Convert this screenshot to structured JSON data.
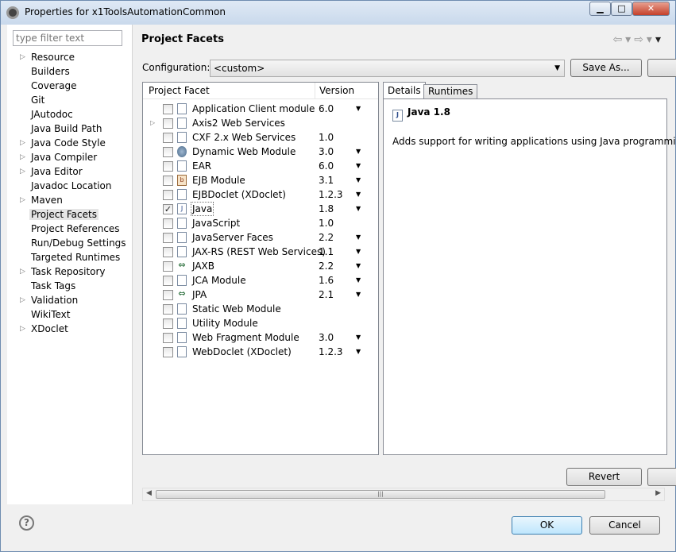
{
  "window": {
    "title": "Properties for x1ToolsAutomationCommon"
  },
  "filter": {
    "placeholder": "type filter text"
  },
  "tree": [
    {
      "label": "Resource",
      "expandable": true
    },
    {
      "label": "Builders",
      "expandable": false
    },
    {
      "label": "Coverage",
      "expandable": false
    },
    {
      "label": "Git",
      "expandable": false
    },
    {
      "label": "JAutodoc",
      "expandable": false
    },
    {
      "label": "Java Build Path",
      "expandable": false
    },
    {
      "label": "Java Code Style",
      "expandable": true
    },
    {
      "label": "Java Compiler",
      "expandable": true
    },
    {
      "label": "Java Editor",
      "expandable": true
    },
    {
      "label": "Javadoc Location",
      "expandable": false
    },
    {
      "label": "Maven",
      "expandable": true
    },
    {
      "label": "Project Facets",
      "expandable": false,
      "selected": true
    },
    {
      "label": "Project References",
      "expandable": false
    },
    {
      "label": "Run/Debug Settings",
      "expandable": false
    },
    {
      "label": "Targeted Runtimes",
      "expandable": false
    },
    {
      "label": "Task Repository",
      "expandable": true
    },
    {
      "label": "Task Tags",
      "expandable": false
    },
    {
      "label": "Validation",
      "expandable": true
    },
    {
      "label": "WikiText",
      "expandable": false
    },
    {
      "label": "XDoclet",
      "expandable": true
    }
  ],
  "page": {
    "title": "Project Facets"
  },
  "configuration": {
    "label": "Configuration:",
    "value": "<custom>",
    "save_as": "Save As..."
  },
  "facets": {
    "col_facet": "Project Facet",
    "col_version": "Version",
    "rows": [
      {
        "name": "Application Client module",
        "version": "6.0",
        "dropdown": true,
        "checked": false,
        "icon": "page-icon"
      },
      {
        "name": "Axis2 Web Services",
        "version": "",
        "dropdown": false,
        "checked": false,
        "icon": "page-icon",
        "expandable": true
      },
      {
        "name": "CXF 2.x Web Services",
        "version": "1.0",
        "dropdown": false,
        "checked": false,
        "icon": "page-icon"
      },
      {
        "name": "Dynamic Web Module",
        "version": "3.0",
        "dropdown": true,
        "checked": false,
        "icon": "globe-icon"
      },
      {
        "name": "EAR",
        "version": "6.0",
        "dropdown": true,
        "checked": false,
        "icon": "page-icon"
      },
      {
        "name": "EJB Module",
        "version": "3.1",
        "dropdown": true,
        "checked": false,
        "icon": "bean-icon"
      },
      {
        "name": "EJBDoclet (XDoclet)",
        "version": "1.2.3",
        "dropdown": true,
        "checked": false,
        "icon": "page-icon"
      },
      {
        "name": "Java",
        "version": "1.8",
        "dropdown": true,
        "checked": true,
        "icon": "java-icon",
        "selected": true
      },
      {
        "name": "JavaScript",
        "version": "1.0",
        "dropdown": false,
        "checked": false,
        "icon": "page-icon"
      },
      {
        "name": "JavaServer Faces",
        "version": "2.2",
        "dropdown": true,
        "checked": false,
        "icon": "page-icon"
      },
      {
        "name": "JAX-RS (REST Web Services)",
        "version": "1.1",
        "dropdown": true,
        "checked": false,
        "icon": "page-icon"
      },
      {
        "name": "JAXB",
        "version": "2.2",
        "dropdown": true,
        "checked": false,
        "icon": "plug-icon"
      },
      {
        "name": "JCA Module",
        "version": "1.6",
        "dropdown": true,
        "checked": false,
        "icon": "page-icon"
      },
      {
        "name": "JPA",
        "version": "2.1",
        "dropdown": true,
        "checked": false,
        "icon": "plug-icon"
      },
      {
        "name": "Static Web Module",
        "version": "",
        "dropdown": false,
        "checked": false,
        "icon": "page-icon"
      },
      {
        "name": "Utility Module",
        "version": "",
        "dropdown": false,
        "checked": false,
        "icon": "page-icon"
      },
      {
        "name": "Web Fragment Module",
        "version": "3.0",
        "dropdown": true,
        "checked": false,
        "icon": "page-icon"
      },
      {
        "name": "WebDoclet (XDoclet)",
        "version": "1.2.3",
        "dropdown": true,
        "checked": false,
        "icon": "page-icon"
      }
    ]
  },
  "details": {
    "tab_details": "Details",
    "tab_runtimes": "Runtimes",
    "title": "Java 1.8",
    "description": "Adds support for writing applications using Java programming lar"
  },
  "buttons": {
    "revert": "Revert",
    "ok": "OK",
    "cancel": "Cancel"
  }
}
